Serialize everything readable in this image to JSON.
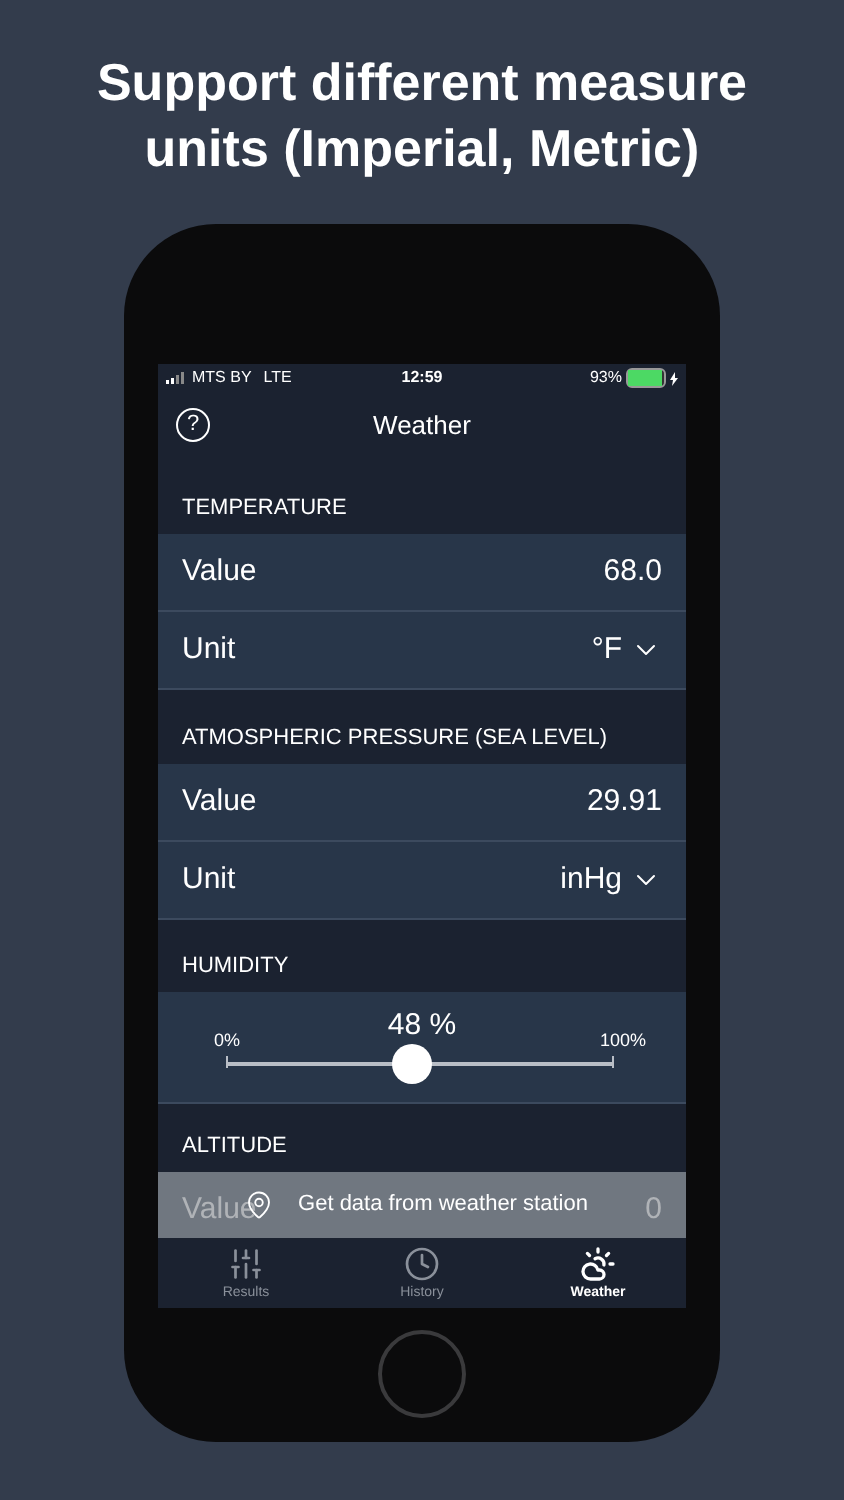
{
  "headline": "Support different measure units (Imperial, Metric)",
  "status_bar": {
    "carrier": "MTS BY",
    "network": "LTE",
    "time": "12:59",
    "battery": "93%",
    "battery_gauge": {
      "level": 0.93
    }
  },
  "nav": {
    "title": "Weather",
    "help": "?"
  },
  "sections": [
    {
      "title": "TEMPERATURE",
      "items": [
        {
          "kind": "value",
          "label": "Value",
          "value": "68.0"
        },
        {
          "kind": "select",
          "label": "Unit",
          "value": "°F"
        }
      ]
    },
    {
      "title": "ATMOSPHERIC PRESSURE (SEA LEVEL)",
      "items": [
        {
          "kind": "value",
          "label": "Value",
          "value": "29.91"
        },
        {
          "kind": "select",
          "label": "Unit",
          "value": "inHg"
        }
      ]
    },
    {
      "title": "HUMIDITY",
      "items": [
        {
          "kind": "slider",
          "min_label": "0%",
          "max_label": "100%",
          "reading": "48 %",
          "level": 0.48
        }
      ]
    },
    {
      "title": "ALTITUDE",
      "items": [
        {
          "kind": "value",
          "label": "Value",
          "value": "0"
        }
      ]
    }
  ],
  "toast": {
    "text": "Get data from weather station"
  },
  "tabs": [
    {
      "label": "Results",
      "selected": false
    },
    {
      "label": "History",
      "selected": false
    },
    {
      "label": "Weather",
      "selected": true
    }
  ]
}
